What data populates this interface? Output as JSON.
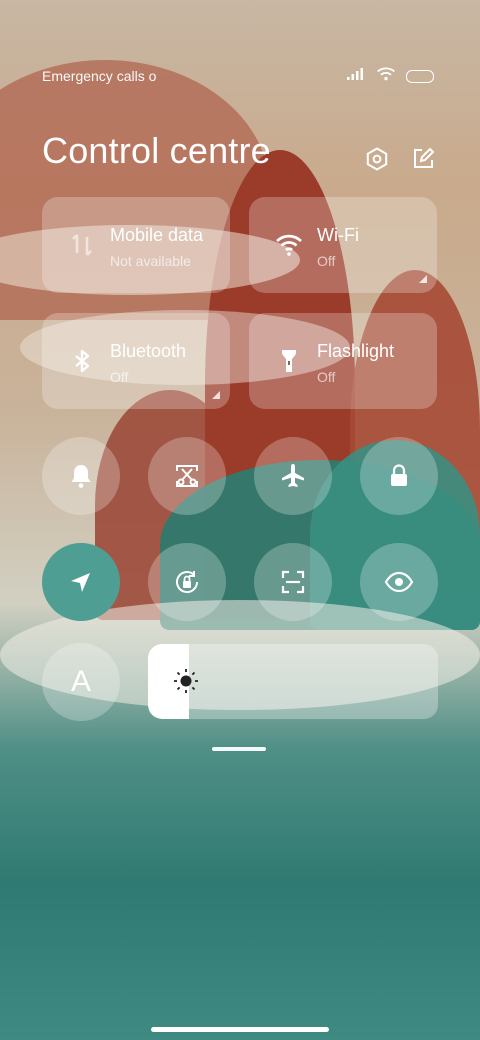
{
  "status_bar": {
    "left_text": "Emergency calls o",
    "icons": [
      "signal-icon",
      "wifi-icon",
      "battery-icon"
    ]
  },
  "header": {
    "title": "Control centre",
    "icons": [
      "settings-icon",
      "edit-icon"
    ]
  },
  "tiles": [
    {
      "label": "Mobile data",
      "sub": "Not available",
      "icon": "mobile-data-icon"
    },
    {
      "label": "Wi-Fi",
      "sub": "Off",
      "icon": "wifi-icon"
    },
    {
      "label": "Bluetooth",
      "sub": "Off",
      "icon": "bluetooth-icon"
    },
    {
      "label": "Flashlight",
      "sub": "Off",
      "icon": "flashlight-icon"
    }
  ],
  "toggles": [
    {
      "name": "bell-icon",
      "active": false
    },
    {
      "name": "screenshot-icon",
      "active": false
    },
    {
      "name": "airplane-icon",
      "active": false
    },
    {
      "name": "lock-icon",
      "active": false
    },
    {
      "name": "location-icon",
      "active": true
    },
    {
      "name": "rotation-lock-icon",
      "active": false
    },
    {
      "name": "scan-icon",
      "active": false
    },
    {
      "name": "eye-icon",
      "active": false
    },
    {
      "name": "font-size-icon",
      "active": false
    }
  ],
  "toggles_label": {
    "font_letter": "A"
  },
  "brightness": {
    "level": 0.14,
    "icon": "sun-icon"
  },
  "colors": {
    "accent": "#4e9e94",
    "tile_bg": "rgba(255,255,255,0.25)"
  }
}
